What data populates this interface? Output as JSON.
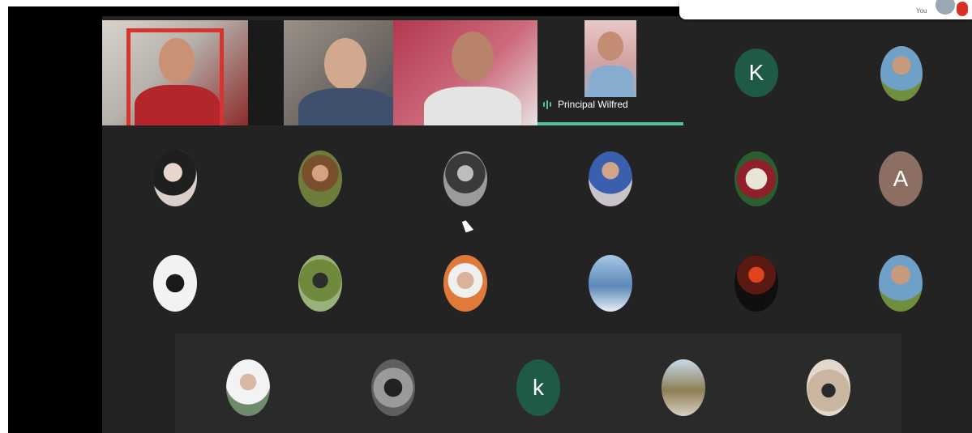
{
  "meeting": {
    "self_label": "You",
    "active_speaker": {
      "name": "Principal Wilfred"
    },
    "colors": {
      "background": "#232323",
      "speaker_highlight": "#4fc3a1",
      "mic_muted": "#d93025"
    }
  },
  "participants": {
    "letter_tiles": [
      {
        "letter": "K",
        "color": "#1e5a47"
      },
      {
        "letter": "A",
        "color": "#8d6e63"
      },
      {
        "letter": "k",
        "color": "#1e5a47"
      }
    ]
  }
}
